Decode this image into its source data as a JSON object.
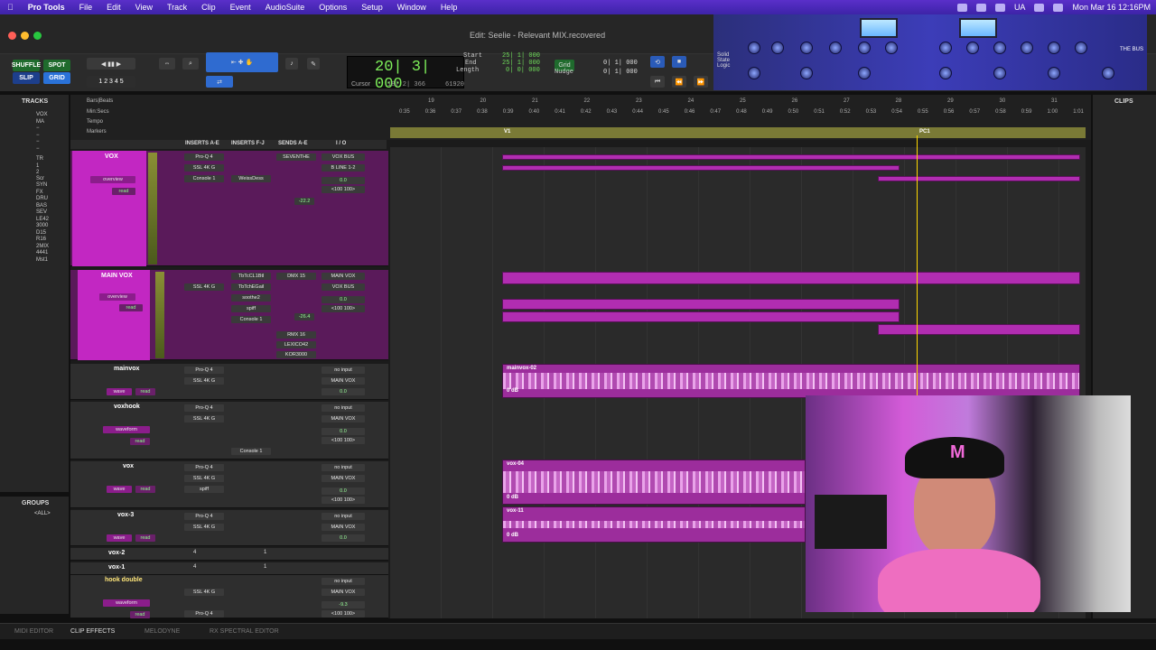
{
  "menubar": {
    "app": "Pro Tools",
    "items": [
      "File",
      "Edit",
      "View",
      "Track",
      "Clip",
      "Event",
      "AudioSuite",
      "Options",
      "Setup",
      "Window",
      "Help"
    ],
    "ua": "UA",
    "datetime": "Mon Mar 16  12:16PM"
  },
  "window": {
    "title": "Edit: Seelie - Relevant MIX.recovered"
  },
  "toolbar": {
    "modes": [
      "SHUFFLE",
      "SPOT",
      "SLIP",
      "GRID"
    ],
    "counter_main": "20| 3| 000",
    "cursor_label": "Cursor",
    "cursor_value": "18| 2| 366",
    "pos_value": "61920",
    "start_label": "Start",
    "end_label": "End",
    "length_label": "Length",
    "start_value": "25| 1| 000",
    "end_value": "25| 1| 000",
    "length_value": "0| 0| 000",
    "grid_label": "Grid",
    "grid_value": "0| 1| 000",
    "nudge_label": "Nudge",
    "nudge_value": "0| 1| 000",
    "pages": [
      "1",
      "2",
      "3",
      "4",
      "5"
    ],
    "plugin_brand": "Solid State Logic",
    "plugin_name": "THE BUS"
  },
  "tracks_panel": {
    "title": "TRACKS",
    "items": [
      "VOX",
      "MA",
      "TR",
      "Scr",
      "SYN",
      "FX",
      "DRU",
      "BAS",
      "SEV",
      "LE42",
      "3000",
      "D15",
      "R16",
      "2MIX",
      "4441",
      "Mst1"
    ]
  },
  "groups_panel": {
    "title": "GROUPS",
    "item": "<ALL>"
  },
  "clips_panel": {
    "title": "CLIPS"
  },
  "rulers": {
    "labels": [
      "Bars|Beats",
      "Min:Secs",
      "Tempo",
      "Markers"
    ],
    "bars": [
      "19",
      "20",
      "21",
      "22",
      "23",
      "24",
      "25",
      "26",
      "27",
      "28",
      "29",
      "30",
      "31"
    ],
    "secs": [
      "0:35",
      "0:36",
      "0:37",
      "0:38",
      "0:39",
      "0:40",
      "0:41",
      "0:42",
      "0:43",
      "0:44",
      "0:45",
      "0:46",
      "0:47",
      "0:48",
      "0:49",
      "0:50",
      "0:51",
      "0:52",
      "0:53",
      "0:54",
      "0:55",
      "0:56",
      "0:57",
      "0:58",
      "0:59",
      "1:00",
      "1:01"
    ],
    "markers": [
      "V1",
      "PC1"
    ]
  },
  "columns": {
    "inserts_ae": "INSERTS A-E",
    "inserts_fj": "INSERTS F-J",
    "sends": "SENDS A-E",
    "io": "I / O"
  },
  "tracks": [
    {
      "name": "VOX",
      "view": "overview",
      "auto": "read",
      "inserts": [
        "Pro-Q 4",
        "SSL 4K G",
        "Console 1"
      ],
      "inserts2": [
        "WeissDess"
      ],
      "sends": [
        "SEVENTHE"
      ],
      "io_in": "VOX BUS",
      "io_out": "B LINE 1-2",
      "vol": "0.0",
      "pan": "<100  100>",
      "fader": "-22.2",
      "send_letters": [
        "b",
        "c",
        "d",
        "e"
      ]
    },
    {
      "name": "MAIN VOX",
      "view": "overview",
      "auto": "read",
      "inserts": [
        "SSL 4K G"
      ],
      "inserts2": [
        "TbTcCL1Btl",
        "TbTchEGail",
        "soothe2",
        "spiff",
        "Console 1"
      ],
      "sends": [
        "DMX 15",
        "RMX 16",
        "LEXICO42",
        "KOR3000"
      ],
      "io_in": "MAIN VOX",
      "io_out": "VOX BUS",
      "vol": "0.0",
      "pan": "<100  100>",
      "fader": "-26.4"
    },
    {
      "name": "mainvox",
      "view": "wave",
      "auto": "read",
      "inserts": [
        "Pro-Q 4",
        "SSL 4K G"
      ],
      "io_in": "no input",
      "io_out": "MAIN VOX",
      "vol": "0.0",
      "clip": "mainvox-02",
      "gain": "0 dB"
    },
    {
      "name": "voxhook",
      "view": "waveform",
      "auto": "read",
      "inserts": [
        "Pro-Q 4",
        "SSL 4K G"
      ],
      "inserts2": [
        "Console 1"
      ],
      "io_in": "no input",
      "io_out": "MAIN VOX",
      "vol": "0.0",
      "pan": "<100  100>"
    },
    {
      "name": "vox",
      "view": "wave",
      "auto": "read",
      "inserts": [
        "Pro-Q 4",
        "SSL 4K G",
        "spiff"
      ],
      "io_in": "no input",
      "io_out": "MAIN VOX",
      "vol": "0.0",
      "pan": "<100  100>",
      "clip": "vox-04",
      "gain": "0 dB"
    },
    {
      "name": "vox-3",
      "view": "wave",
      "auto": "read",
      "inserts": [
        "Pro-Q 4",
        "SSL 4K G"
      ],
      "io_in": "no input",
      "io_out": "MAIN VOX",
      "vol": "0.0",
      "clip": "vox-11",
      "gain": "0 dB"
    },
    {
      "name": "vox-2",
      "ins": "4",
      "io": "1"
    },
    {
      "name": "vox-1",
      "ins": "4",
      "io": "1"
    },
    {
      "name": "hook double",
      "view": "waveform",
      "auto": "read",
      "inserts": [
        "SSL 4K G",
        "Pro-Q 4"
      ],
      "io_in": "no input",
      "io_out": "MAIN VOX",
      "vol": "-9.3",
      "pan": "<100  100>"
    }
  ],
  "bottom_tabs": [
    "MIDI EDITOR",
    "CLIP EFFECTS",
    "MELODYNE",
    "RX SPECTRAL EDITOR"
  ]
}
